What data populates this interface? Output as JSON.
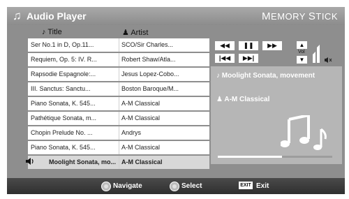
{
  "header": {
    "title": "Audio Player",
    "brand": "Memory Stick",
    "icon": "music-note-icon"
  },
  "columns": {
    "title": "Title",
    "artist": "Artist"
  },
  "rows": [
    {
      "title": "Ser No.1 in D, Op.11...",
      "artist": "SCO/Sir Charles..."
    },
    {
      "title": "Requiem, Op. 5: IV. R...",
      "artist": "Robert Shaw/Atla..."
    },
    {
      "title": "Rapsodie Espagnole:...",
      "artist": "Jesus Lopez-Cobo..."
    },
    {
      "title": "III. Sanctus: Sanctu...",
      "artist": "Boston Baroque/M..."
    },
    {
      "title": "Piano Sonata, K. 545...",
      "artist": "A-M Classical"
    },
    {
      "title": "Pathétique Sonata, m...",
      "artist": "A-M Classical"
    },
    {
      "title": "Chopin Prelude No. ...",
      "artist": "Andrys"
    },
    {
      "title": "Piano Sonata, K. 545...",
      "artist": "A-M Classical"
    },
    {
      "title": "Moolight Sonata, mo...",
      "artist": "A-M Classical",
      "playing": true
    }
  ],
  "controls": {
    "rewind": "◀◀",
    "pause": "❚❚",
    "fast_forward": "▶▶",
    "previous": "|◀◀",
    "next": "▶▶|",
    "volume_label": "Vol",
    "volume_up": "▲",
    "volume_down": "▼",
    "mute": "🔇"
  },
  "now_playing": {
    "title": "Moolight Sonata, movement",
    "artist": "A-M Classical",
    "progress": 0.56
  },
  "footer": {
    "navigate": "Navigate",
    "select": "Select",
    "exit_key": "EXIT",
    "exit": "Exit"
  },
  "colors": {
    "background": "#8e8e8e",
    "panel": "#b6b6b6",
    "footer": "#3a3a3a",
    "highlight": "#d8d8d8"
  }
}
